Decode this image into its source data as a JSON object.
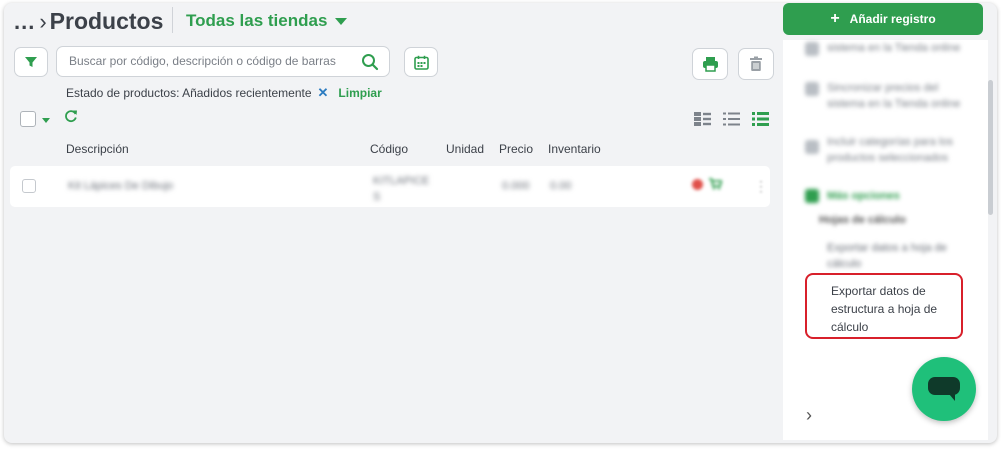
{
  "header": {
    "breadcrumb_dots": "...",
    "title": "Productos",
    "store_selector": "Todas las tiendas",
    "add_button": "Añadir registro"
  },
  "toolbar": {
    "search_placeholder": "Buscar por código, descripción o código de barras"
  },
  "filter": {
    "label": "Estado de productos: Añadidos recientemente",
    "clear": "Limpiar"
  },
  "table": {
    "columns": [
      "Descripción",
      "Código",
      "Unidad",
      "Precio",
      "Inventario"
    ],
    "rows": [
      {
        "description": "Kit Lápices De Dibujo",
        "code_line1": "KITLAPICE",
        "code_line2": "S",
        "price": "0.000",
        "inventory": "0.00"
      }
    ]
  },
  "sidebar": {
    "blurred_items": [
      "sistema en la Tienda online",
      "Sincronizar precios del sistema en la Tienda online",
      "Incluir categorías para los productos seleccionados"
    ],
    "section": "Más opciones",
    "subsection": "Hojas de cálculo",
    "export_data": "Exportar datos a hoja de cálculo",
    "export_structure": "Exportar datos de estructura a hoja de cálculo"
  },
  "colors": {
    "brand_green": "#2f9e4f",
    "highlight_red": "#d8202b",
    "chat_green": "#1fc07a"
  }
}
